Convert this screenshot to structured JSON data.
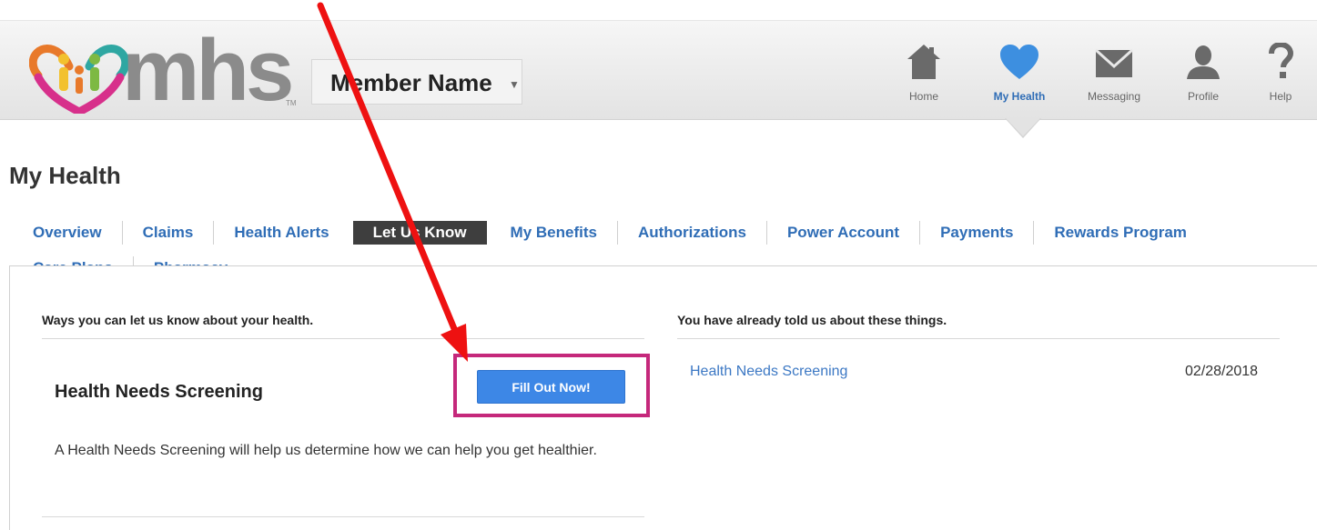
{
  "brand": {
    "logo_text": "mhs",
    "trademark": "TM"
  },
  "member": {
    "name": "Member Name"
  },
  "topnav": [
    {
      "label": "Home",
      "icon": "home-icon"
    },
    {
      "label": "My Health",
      "icon": "heart-icon",
      "active": true
    },
    {
      "label": "Messaging",
      "icon": "envelope-icon"
    },
    {
      "label": "Profile",
      "icon": "person-icon"
    },
    {
      "label": "Help",
      "icon": "question-icon"
    }
  ],
  "page": {
    "title": "My Health"
  },
  "tabs": {
    "row1": [
      "Overview",
      "Claims",
      "Health Alerts",
      "Let Us Know",
      "My Benefits",
      "Authorizations",
      "Power Account",
      "Payments",
      "Rewards Program"
    ],
    "row2": [
      "Care Plans",
      "Pharmacy"
    ],
    "active": "Let Us Know"
  },
  "left_panel": {
    "heading": "Ways you can let us know about your health.",
    "item_title": "Health Needs Screening",
    "button_label": "Fill Out Now!",
    "description": "A Health Needs Screening will help us determine how we can help you get healthier."
  },
  "right_panel": {
    "heading": "You have already told us about these things.",
    "items": [
      {
        "label": "Health Needs Screening",
        "date": "02/28/2018"
      }
    ]
  },
  "colors": {
    "accent": "#2f6db6",
    "button": "#3d87e6",
    "highlight": "#c5287b",
    "arrow": "#ee1111",
    "active_tab": "#3e3e3e"
  }
}
